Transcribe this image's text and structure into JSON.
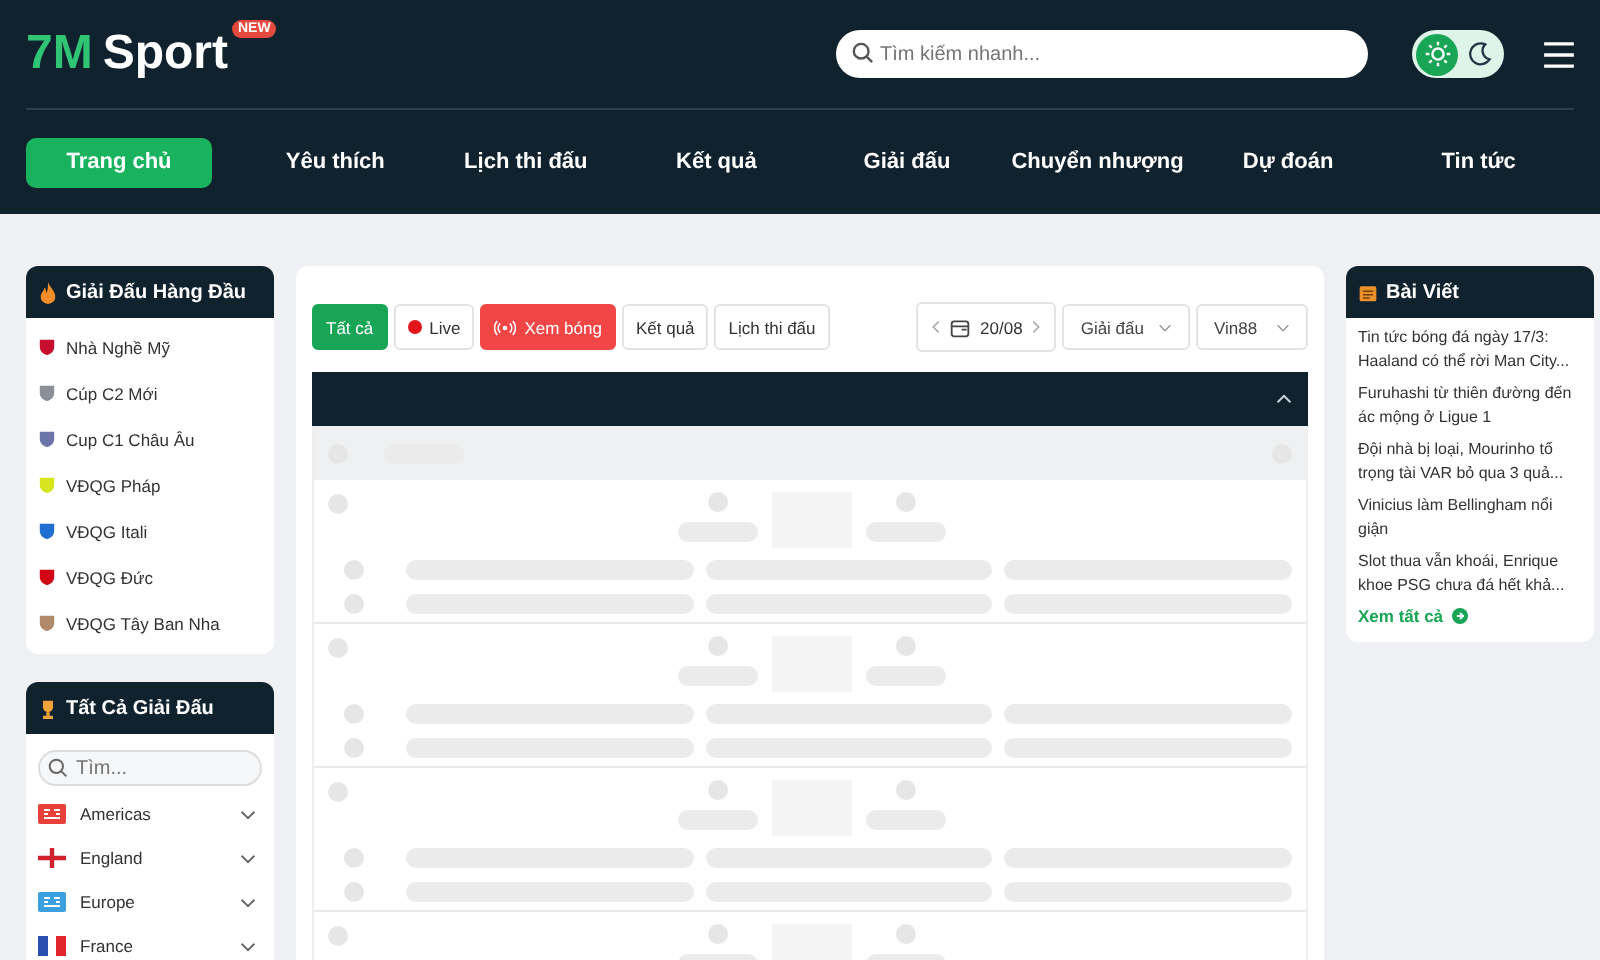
{
  "header": {
    "logo_prefix": "7M",
    "logo_name": "Sport",
    "logo_badge": "NEW",
    "search": {
      "placeholder": "Tìm kiếm nhanh..."
    },
    "dark_mode": false
  },
  "nav": [
    {
      "label": "Trang chủ",
      "selected": true
    },
    {
      "label": "Yêu thích",
      "selected": false
    },
    {
      "label": "Lịch thi đấu",
      "selected": false
    },
    {
      "label": "Kết quả",
      "selected": false
    },
    {
      "label": "Giải đấu",
      "selected": false
    },
    {
      "label": "Chuyển nhượng",
      "selected": false
    },
    {
      "label": "Dự đoán",
      "selected": false
    },
    {
      "label": "Tin tức",
      "selected": false
    }
  ],
  "top_leagues": {
    "title": "Giải Đấu Hàng Đầu",
    "items": [
      {
        "name": "Nhà Nghề Mỹ",
        "color": "#c8102e"
      },
      {
        "name": "Cúp C2 Mới",
        "color": "#8a8f98"
      },
      {
        "name": "Cup C1 Châu Âu",
        "color": "#6b74a8"
      },
      {
        "name": "VĐQG Pháp",
        "color": "#d7e51e"
      },
      {
        "name": "VĐQG Itali",
        "color": "#1f6fd1"
      },
      {
        "name": "VĐQG Đức",
        "color": "#d20515"
      },
      {
        "name": "VĐQG Tây Ban Nha",
        "color": "#b08a6a"
      }
    ]
  },
  "all_leagues": {
    "title": "Tất Cả Giải Đấu",
    "search": {
      "placeholder": "Tìm..."
    },
    "items": [
      {
        "name": "Americas",
        "kind": "badge",
        "color": "#e8413c"
      },
      {
        "name": "England",
        "kind": "cross",
        "color": "#d0202e"
      },
      {
        "name": "Europe",
        "kind": "badge",
        "color": "#3aa0e0"
      },
      {
        "name": "France",
        "kind": "tricolor",
        "color": "#2a4fb0"
      }
    ]
  },
  "filters": [
    {
      "label": "Tất cả",
      "kind": "plain",
      "selected": true
    },
    {
      "label": "Live",
      "kind": "live",
      "selected": false
    },
    {
      "label": "Xem bóng",
      "kind": "stream",
      "selected": false
    },
    {
      "label": "Kết quả",
      "kind": "plain",
      "selected": false
    },
    {
      "label": "Lịch thi đấu",
      "kind": "plain",
      "selected": false
    }
  ],
  "date": "20/08",
  "dropdowns": [
    "Giải đấu",
    "Vin88"
  ],
  "articles": {
    "title": "Bài Viết",
    "items": [
      "Tin tức bóng đá ngày 17/3: Haaland có thể rời Man City...",
      "Furuhashi từ thiên đường đến ác mộng ở Ligue 1",
      "Đội nhà bị loại, Mourinho tố trọng tài VAR bỏ qua 3 quả...",
      "Vinicius làm Bellingham nổi giận",
      "Slot thua vẫn khoái, Enrique khoe PSG chưa đá hết khả..."
    ],
    "more": "Xem tất cả"
  }
}
